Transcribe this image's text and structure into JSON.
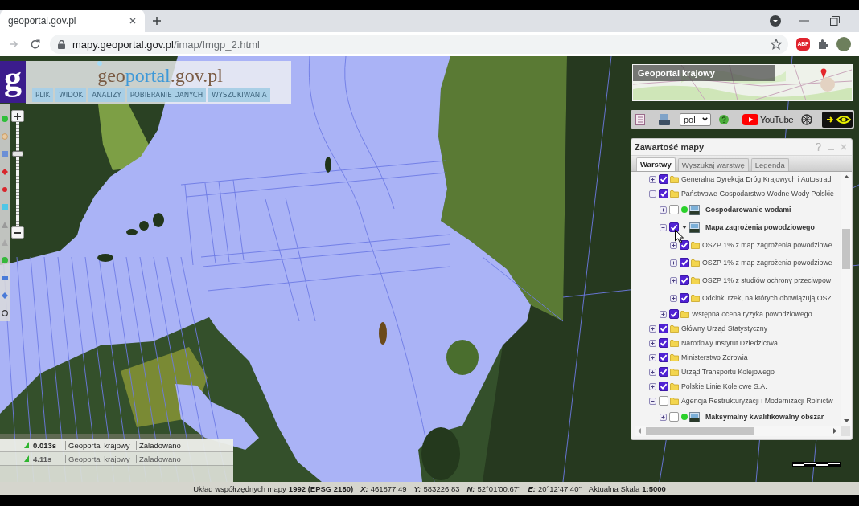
{
  "browser": {
    "tab_title": "geoportal.gov.pl",
    "url_host": "mapy.geoportal.gov.pl",
    "url_path": "/imap/Imgp_2.html",
    "forward_disabled": true,
    "extension_badge": "ABP"
  },
  "header": {
    "logo_mark": "g",
    "title_parts": [
      "geo",
      "portal",
      ".gov.pl"
    ],
    "menu": [
      "PLIK",
      "WIDOK",
      "ANALIZY",
      "POBIERANIE DANYCH",
      "WYSZUKIWANIA"
    ]
  },
  "zoom": {
    "level": 0.71
  },
  "overview_map": {
    "title": "Geoportal krajowy"
  },
  "toolbar": {
    "language": "pol",
    "video_label": "YouTube"
  },
  "layers_panel": {
    "title": "Zawartość mapy",
    "tabs": [
      {
        "label": "Warstwy",
        "selected": true
      },
      {
        "label": "Wyszukaj warstwę",
        "selected": false
      },
      {
        "label": "Legenda",
        "selected": false
      }
    ],
    "tree": [
      {
        "label": "Generalna Dyrekcja Dróg Krajowych i Autostrad",
        "kind": "folder",
        "checked": true,
        "expanded": false
      },
      {
        "label": "Państwowe Gospodarstwo Wodne Wody Polskie",
        "kind": "folder",
        "checked": true,
        "expanded": true,
        "children": [
          {
            "label": "Gospodarowanie wodami",
            "kind": "service",
            "status_dot": true,
            "options_arrow": false,
            "checked": false,
            "expanded": false
          },
          {
            "label": "Mapa zagrożenia powodziowego",
            "kind": "service",
            "status_dot": false,
            "options_arrow": true,
            "checked": true,
            "expanded": true,
            "children": [
              {
                "label": "OSZP 1% z map zagrożenia powodziowe",
                "kind": "folder",
                "checked": true,
                "expanded": false
              },
              {
                "label": "OSZP 1% z map zagrożenia powodziowe",
                "kind": "folder",
                "checked": true,
                "expanded": false
              },
              {
                "label": "OSZP 1% z studiów ochrony przeciwpow",
                "kind": "folder",
                "checked": true,
                "expanded": false
              },
              {
                "label": "Odcinki rzek, na których obowiązują OSZ",
                "kind": "folder",
                "checked": true,
                "expanded": false
              }
            ]
          },
          {
            "label": "Wstępna ocena ryzyka powodziowego",
            "kind": "folder",
            "checked": true,
            "expanded": false
          }
        ]
      },
      {
        "label": "Główny Urząd Statystyczny",
        "kind": "folder",
        "checked": true,
        "expanded": false
      },
      {
        "label": "Narodowy Instytut Dziedzictwa",
        "kind": "folder",
        "checked": true,
        "expanded": false
      },
      {
        "label": "Ministerstwo Zdrowia",
        "kind": "folder",
        "checked": true,
        "expanded": false
      },
      {
        "label": "Urząd Transportu Kolejowego",
        "kind": "folder",
        "checked": true,
        "expanded": false
      },
      {
        "label": "Polskie Linie Kolejowe S.A.",
        "kind": "folder",
        "checked": true,
        "expanded": false
      },
      {
        "label": "Agencja Restrukturyzacji i Modernizacji Rolnictw",
        "kind": "folder",
        "checked": false,
        "expanded": true,
        "children": [
          {
            "label": "Maksymalny kwalifikowalny obszar",
            "kind": "service",
            "status_dot": true,
            "options_arrow": false,
            "checked": false,
            "expanded": false
          }
        ]
      }
    ]
  },
  "load_status": [
    {
      "time": "0.013s",
      "source": "Geoportal krajowy",
      "status": "Zaladowano",
      "dimmed": false
    },
    {
      "time": "4.11s",
      "source": "Geoportal krajowy",
      "status": "Zaladowano",
      "dimmed": true
    }
  ],
  "status_bar": [
    {
      "kind": "named",
      "label": "Układ współrzędnych mapy",
      "value": "1992 (EPSG 2180)"
    },
    {
      "kind": "axis",
      "label": "X:",
      "value": "461877.49"
    },
    {
      "kind": "axis",
      "label": "Y:",
      "value": "583226.83"
    },
    {
      "kind": "axis",
      "label": "N:",
      "value": "52°01'00.67\""
    },
    {
      "kind": "axis",
      "label": "E:",
      "value": "20°12'47.40\""
    },
    {
      "kind": "named",
      "label": "Aktualna Skala",
      "value": "1:5000"
    }
  ]
}
